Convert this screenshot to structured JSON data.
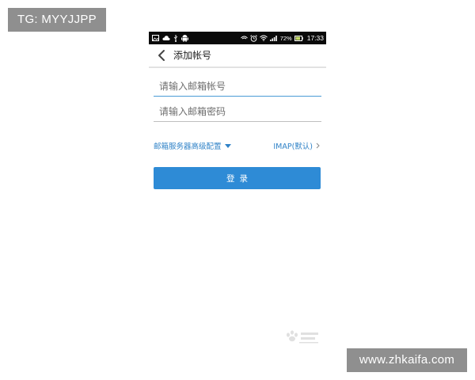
{
  "overlay": {
    "top_left_badge": "TG: MYYJJPP",
    "bottom_right_badge": "www.zhkaifa.com",
    "watermark_text": "Baidu 经验"
  },
  "status_bar": {
    "left_icons": [
      "image-icon",
      "cloud-icon",
      "usb-icon",
      "android-icon"
    ],
    "right_icons": [
      "vibrate-icon",
      "alarm-icon",
      "wifi-icon",
      "signal-icon",
      "battery-icon"
    ],
    "battery_percent": "72%",
    "time": "17:33"
  },
  "header": {
    "title": "添加帐号"
  },
  "form": {
    "account_placeholder": "请输入邮箱帐号",
    "password_placeholder": "请输入邮箱密码",
    "advanced_settings_label": "邮箱服务器高级配置",
    "protocol_label": "IMAP(默认)",
    "login_label": "登录"
  },
  "colors": {
    "accent": "#2e8bd6",
    "link": "#2f82c7",
    "status_bar_bg": "#0a0a0a",
    "overlay_badge_bg": "#8f8f8f"
  }
}
